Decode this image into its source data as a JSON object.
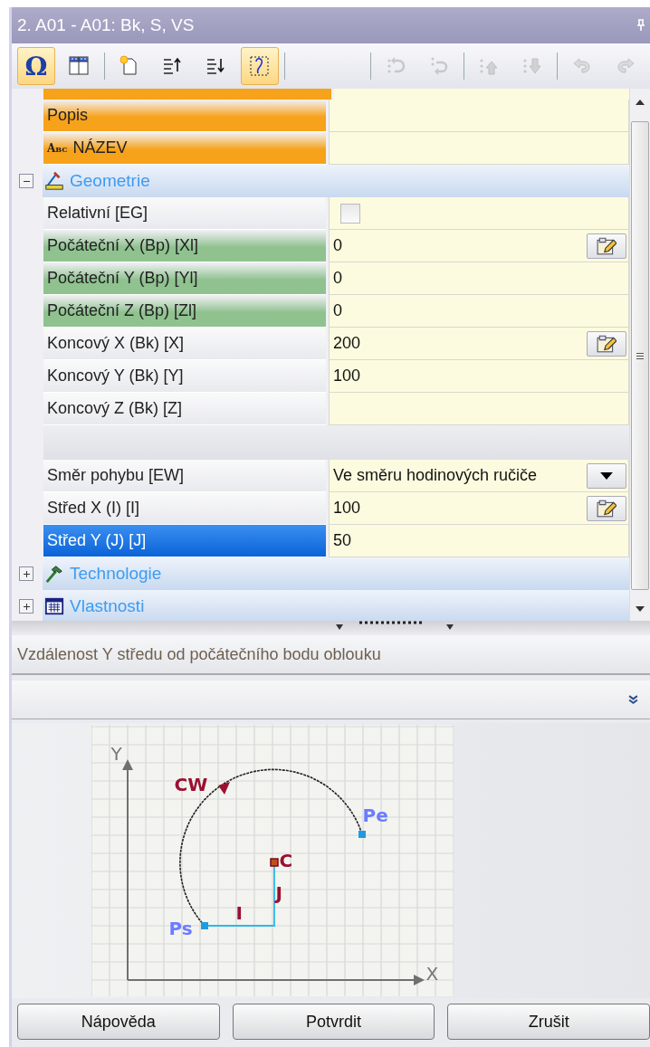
{
  "window": {
    "title": "2. A01 - A01: Bk, S, VS"
  },
  "toolbar": {
    "buttons": [
      {
        "label": "Ω",
        "selected": true,
        "disabled": false
      },
      {
        "selected": false,
        "disabled": false
      },
      {
        "selected": false,
        "disabled": false
      },
      {
        "selected": false,
        "disabled": false
      },
      {
        "selected": false,
        "disabled": false
      },
      {
        "selected": true,
        "disabled": false
      },
      {
        "selected": false,
        "disabled": true
      },
      {
        "selected": false,
        "disabled": true
      },
      {
        "selected": false,
        "disabled": true
      },
      {
        "selected": false,
        "disabled": true
      },
      {
        "selected": false,
        "disabled": true
      },
      {
        "selected": false,
        "disabled": true
      }
    ]
  },
  "rows": [
    {
      "kind": "property",
      "label": "Popis",
      "value": "",
      "color": "#f7a21b",
      "editor": false,
      "selected": false
    },
    {
      "kind": "property",
      "prefix": "Abc",
      "label": "NÁZEV",
      "value": "",
      "color": "#f7a21b",
      "editor": false,
      "selected": false
    },
    {
      "kind": "group",
      "label": "Geometrie",
      "expanded": true
    },
    {
      "kind": "checkbox",
      "label": "Relativní [EG]",
      "checked": false,
      "selected": false
    },
    {
      "kind": "property",
      "label": "Počáteční X (Bp) [Xl]",
      "value": "0",
      "color": "#8fc28f",
      "editor": true,
      "selected": false
    },
    {
      "kind": "property",
      "label": "Počáteční Y (Bp) [Yl]",
      "value": "0",
      "color": "#8fc28f",
      "editor": false,
      "selected": false
    },
    {
      "kind": "property",
      "label": "Počáteční Z (Bp) [Zl]",
      "value": "0",
      "color": "#8fc28f",
      "editor": false,
      "selected": false
    },
    {
      "kind": "property",
      "label": "Koncový X (Bk) [X]",
      "value": "200",
      "editor": true,
      "selected": false
    },
    {
      "kind": "property",
      "label": "Koncový Y (Bk) [Y]",
      "value": "100",
      "editor": false,
      "selected": false
    },
    {
      "kind": "property",
      "label": "Koncový Z (Bk) [Z]",
      "value": "",
      "editor": false,
      "selected": false
    },
    {
      "kind": "spacer"
    },
    {
      "kind": "dropdown",
      "label": "Směr pohybu [EW]",
      "value": "Ve směru hodinových ručiče",
      "selected": false
    },
    {
      "kind": "property",
      "label": "Střed X (I) [I]",
      "value": "100",
      "editor": true,
      "selected": false
    },
    {
      "kind": "property",
      "label": "Střed Y (J) [J]",
      "value": "50",
      "editor": false,
      "selected": true
    },
    {
      "kind": "group",
      "label": "Technologie",
      "expanded": false
    },
    {
      "kind": "group",
      "label": "Vlastnosti",
      "expanded": false
    }
  ],
  "description": "Vzdálenost Y středu od počátečního bodu oblouku",
  "diagram": {
    "labels": {
      "y_axis": "Y",
      "x_axis": "X",
      "direction": "CW",
      "end": "Pe",
      "start": "Ps",
      "center": "C",
      "j": "J",
      "i": "I"
    }
  },
  "buttons": [
    "Nápověda",
    "Potvrdit",
    "Zrušit"
  ]
}
